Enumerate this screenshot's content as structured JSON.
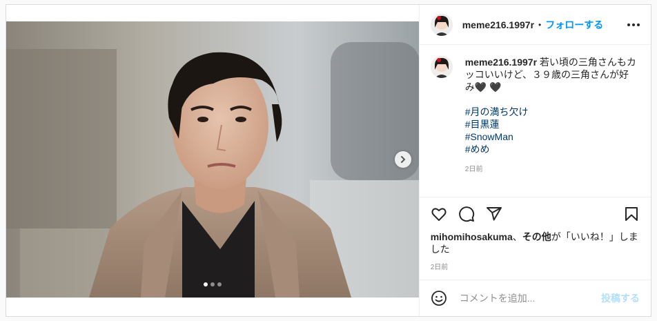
{
  "post": {
    "username": "meme216.1997r",
    "follow_label": "フォローする",
    "separator": "•",
    "photo_alt": "man in beige coat",
    "carousel": {
      "count": 3,
      "active": 0
    }
  },
  "caption": {
    "username": "meme216.1997r",
    "text": " 若い頃の三角さんもカッコいいけど、３９歳の三角さんが好み🖤 🖤",
    "hashtags": [
      "#月の満ち欠け",
      "#目黒蓮",
      "#SnowMan",
      "#めめ"
    ],
    "time": "2日前"
  },
  "likes": {
    "user": "mihomihosakuma",
    "mid": "、",
    "others": "その他",
    "suffix": "が「いいね！」しました"
  },
  "post_time": "2日前",
  "comment": {
    "placeholder": "コメントを追加...",
    "post_label": "投稿する"
  },
  "icons": [
    "heart-icon",
    "comment-icon",
    "share-icon",
    "bookmark-icon",
    "emoji-icon",
    "more-icon",
    "chevron-right-icon"
  ],
  "colors": {
    "accent": "#0095f6",
    "hashtag": "#00376b",
    "muted": "#8e8e8e",
    "border": "#dbdbdb"
  }
}
